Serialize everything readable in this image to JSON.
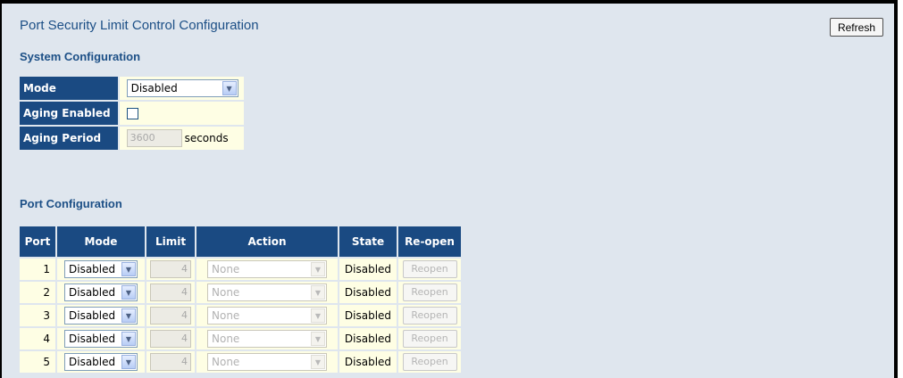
{
  "page": {
    "title": "Port Security Limit Control Configuration",
    "refresh_label": "Refresh"
  },
  "system": {
    "heading": "System Configuration",
    "mode_label": "Mode",
    "mode_value": "Disabled",
    "aging_enabled_label": "Aging Enabled",
    "aging_enabled_checked": false,
    "aging_period_label": "Aging Period",
    "aging_period_value": "3600",
    "aging_period_unit": "seconds"
  },
  "ports": {
    "heading": "Port Configuration",
    "columns": [
      "Port",
      "Mode",
      "Limit",
      "Action",
      "State",
      "Re-open"
    ],
    "rows": [
      {
        "port": "1",
        "mode": "Disabled",
        "limit": "4",
        "action": "None",
        "state": "Disabled",
        "reopen": "Reopen"
      },
      {
        "port": "2",
        "mode": "Disabled",
        "limit": "4",
        "action": "None",
        "state": "Disabled",
        "reopen": "Reopen"
      },
      {
        "port": "3",
        "mode": "Disabled",
        "limit": "4",
        "action": "None",
        "state": "Disabled",
        "reopen": "Reopen"
      },
      {
        "port": "4",
        "mode": "Disabled",
        "limit": "4",
        "action": "None",
        "state": "Disabled",
        "reopen": "Reopen"
      },
      {
        "port": "5",
        "mode": "Disabled",
        "limit": "4",
        "action": "None",
        "state": "Disabled",
        "reopen": "Reopen"
      }
    ]
  },
  "icons": {
    "dropdown": "chevron-down-icon"
  },
  "colors": {
    "header_bg": "#1a4a82",
    "cell_bg": "#fefee4",
    "title": "#1c4f86",
    "page_bg": "#dfe6ee"
  }
}
